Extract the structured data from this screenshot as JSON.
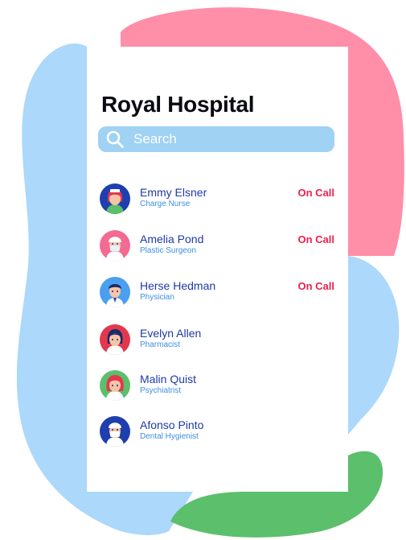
{
  "colors": {
    "blob_blue": "#abd8fb",
    "blob_pink": "#ff8ea9",
    "blob_green": "#5cbf6c",
    "search_bg": "#9fd2f3",
    "name": "#1d3aa6",
    "role": "#3d8fe0",
    "on_call": "#ef1f4f"
  },
  "app": {
    "title": "Royal Hospital"
  },
  "search": {
    "placeholder": "Search",
    "icon": "search-icon"
  },
  "staff": [
    {
      "name": "Emmy Elsner",
      "role": "Charge Nurse",
      "status": "On Call",
      "avatar": "nurse-avatar"
    },
    {
      "name": "Amelia Pond",
      "role": "Plastic Surgeon",
      "status": "On Call",
      "avatar": "surgeon-avatar"
    },
    {
      "name": "Herse Hedman",
      "role": "Physician",
      "status": "On Call",
      "avatar": "physician-avatar"
    },
    {
      "name": "Evelyn Allen",
      "role": "Pharmacist",
      "status": "",
      "avatar": "pharmacist-avatar"
    },
    {
      "name": "Malin Quist",
      "role": "Psychiatrist",
      "status": "",
      "avatar": "psychiatrist-avatar"
    },
    {
      "name": "Afonso Pinto",
      "role": "Dental Hygienist",
      "status": "",
      "avatar": "hygienist-avatar"
    }
  ]
}
